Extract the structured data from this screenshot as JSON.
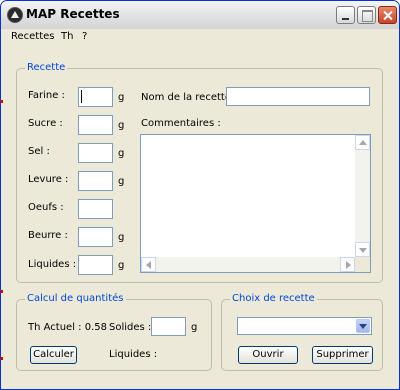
{
  "window": {
    "title": "MAP Recettes"
  },
  "menu": {
    "items": [
      "Recettes",
      "Th",
      "?"
    ]
  },
  "recette": {
    "legend": "Recette",
    "ingredients": [
      {
        "label": "Farine :",
        "value": "",
        "unit": "g"
      },
      {
        "label": "Sucre :",
        "value": "",
        "unit": "g"
      },
      {
        "label": "Sel :",
        "value": "",
        "unit": "g"
      },
      {
        "label": "Levure :",
        "value": "",
        "unit": "g"
      },
      {
        "label": "Oeufs :",
        "value": "",
        "unit": ""
      },
      {
        "label": "Beurre :",
        "value": "",
        "unit": "g"
      },
      {
        "label": "Liquides :",
        "value": "",
        "unit": "g"
      }
    ],
    "name_label": "Nom de la recette :",
    "name_value": "",
    "comments_label": "Commentaires :",
    "comments_value": ""
  },
  "calcul": {
    "legend": "Calcul de quantités",
    "th_actuel": "Th Actuel : 0.58",
    "solides_label": "Solides :",
    "solides_value": "",
    "solides_unit": "g",
    "liquides_label": "Liquides :",
    "calculer_label": "Calculer"
  },
  "choix": {
    "legend": "Choix de recette",
    "selected": "",
    "ouvrir_label": "Ouvrir",
    "supprimer_label": "Supprimer"
  }
}
